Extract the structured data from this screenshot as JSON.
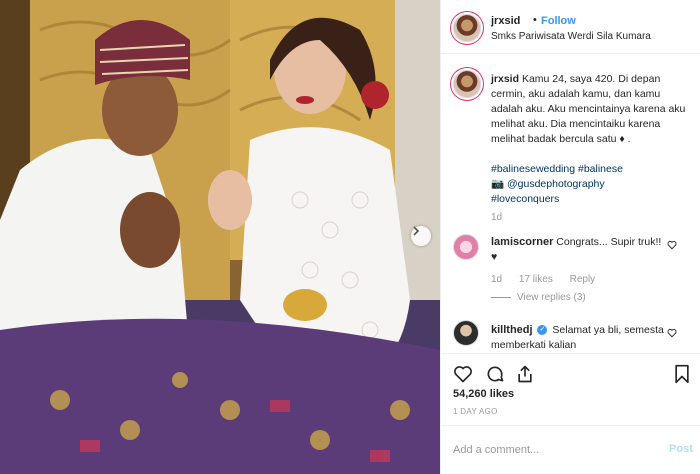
{
  "post": {
    "username": "jrxsid",
    "follow_label": "Follow",
    "dot": "•",
    "location": "Smks Pariwisata Werdi Sila Kumara"
  },
  "caption": {
    "username": "jrxsid",
    "text": "Kamu 24, saya 420. Di depan cermin, aku adalah kamu, dan kamu adalah aku. Aku mencintainya karena aku melihat aku. Dia mencintaiku karena melihat badak bercula satu ♦ .",
    "hashtags_line1": "#balinesewedding #balinese",
    "camera": "📷",
    "photographer": "@gusdephotography",
    "hashtags_line2": "#loveconquers",
    "age": "1d"
  },
  "comments": [
    {
      "username": "lamiscorner",
      "text": "Congrats... Supir truk!! ♥",
      "age": "1d",
      "likes": "17 likes",
      "reply_label": "Reply",
      "view_replies": "View replies (3)"
    },
    {
      "username": "killthedj",
      "verified": "✓",
      "text": "Selamat ya bli, semesta memberkati kalian"
    }
  ],
  "stats": {
    "likes": "54,260 likes",
    "age": "1 DAY AGO"
  },
  "add_comment": {
    "placeholder": "Add a comment...",
    "post_label": "Post"
  },
  "colors": {
    "link": "#3897f0",
    "hashtag": "#003569",
    "muted": "#999999",
    "post_disabled": "#b2dffc"
  },
  "icons": {
    "like": "heart-icon",
    "comment": "comment-icon",
    "share": "share-icon",
    "save": "bookmark-icon",
    "next": "chevron-right-icon"
  }
}
